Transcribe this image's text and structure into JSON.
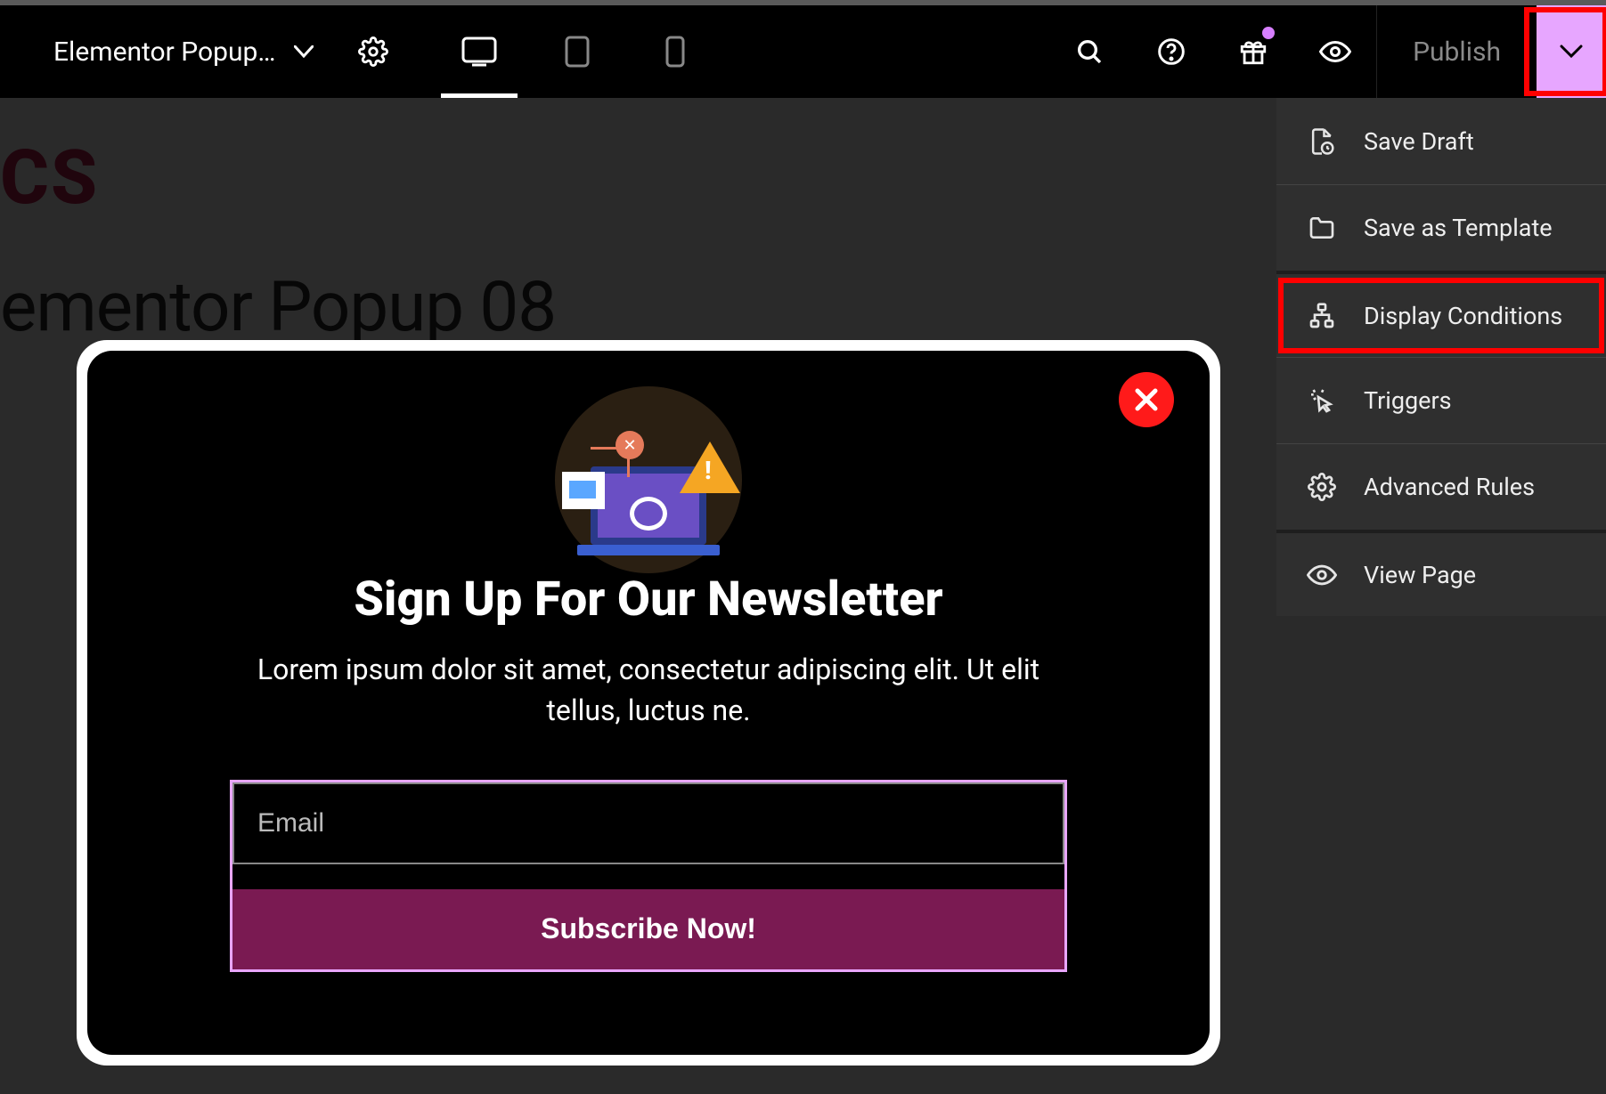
{
  "toolbar": {
    "doc_title": "Elementor Popup…",
    "publish_label": "Publish"
  },
  "canvas": {
    "brand_fragment": "CS",
    "heading_fragment": "ementor Popup 08"
  },
  "popup": {
    "title": "Sign Up For Our Newsletter",
    "description": "Lorem ipsum dolor sit amet, consectetur adipiscing elit. Ut elit tellus, luctus ne.",
    "email_placeholder": "Email",
    "submit_label": "Subscribe Now!"
  },
  "save_menu": {
    "items": [
      {
        "label": "Save Draft",
        "icon": "file-clock-icon"
      },
      {
        "label": "Save as Template",
        "icon": "folder-icon"
      },
      {
        "label": "Display Conditions",
        "icon": "flow-icon",
        "highlighted": true,
        "section_start": true
      },
      {
        "label": "Triggers",
        "icon": "click-icon"
      },
      {
        "label": "Advanced Rules",
        "icon": "gear-icon"
      },
      {
        "label": "View Page",
        "icon": "eye-icon",
        "section_start": true
      }
    ]
  }
}
